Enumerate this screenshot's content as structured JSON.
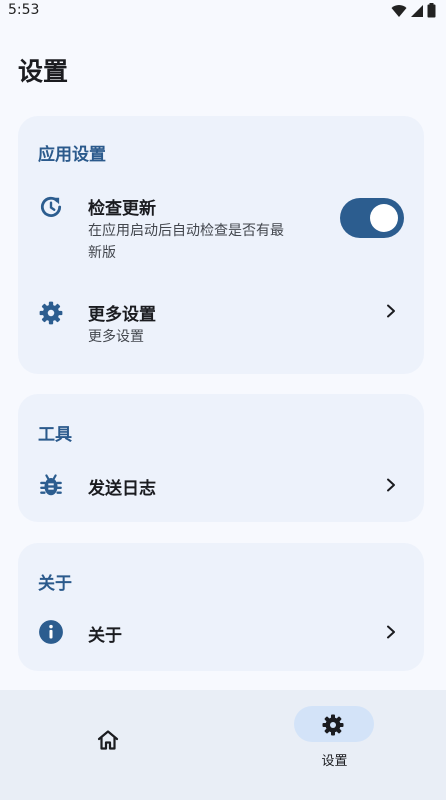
{
  "status_bar": {
    "time": "5:53"
  },
  "page": {
    "title": "设置"
  },
  "sections": {
    "app_settings": {
      "header": "应用设置",
      "check_update": {
        "title": "检查更新",
        "subtitle_line1": "在应用启动后自动检查是否有最",
        "subtitle_line2": "新版",
        "toggle_on": true
      },
      "more_settings": {
        "title": "更多设置",
        "subtitle": "更多设置"
      }
    },
    "tools": {
      "header": "工具",
      "send_log": {
        "title": "发送日志"
      }
    },
    "about": {
      "header": "关于",
      "about_item": {
        "title": "关于"
      }
    }
  },
  "bottom_nav": {
    "home_icon": "home-icon",
    "settings_label": "设置",
    "active": "settings"
  },
  "colors": {
    "accent": "#2c5d8f",
    "header_text": "#2b5a8c",
    "card_bg": "#edf2fb",
    "page_bg": "#f7f9fe",
    "nav_active_pill": "#d3e3f8"
  }
}
